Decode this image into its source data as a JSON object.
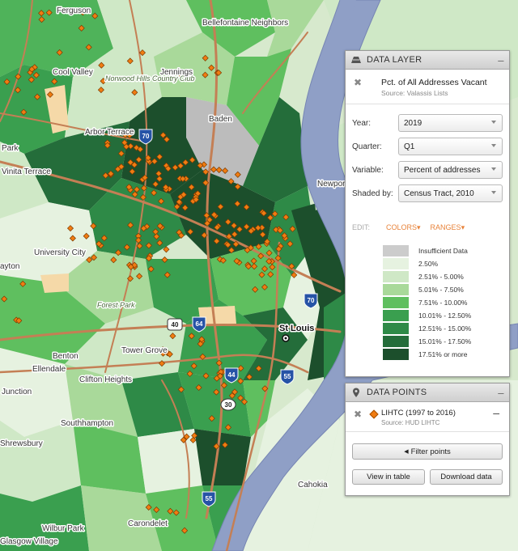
{
  "map": {
    "places": [
      "Ferguson",
      "Bellefontaine Neighbors",
      "Cool Valley",
      "Norwood Hills Country Club",
      "Jennings",
      "Arbor Terrace",
      "Baden",
      "Park",
      "Vinita Terrace",
      "Newport",
      "University City",
      "ayton",
      "Forest Park",
      "St Louis",
      "Tower Grove",
      "Benton",
      "Ellendale",
      "Clifton Heights",
      "Junction",
      "Southhampton",
      "Shrewsbury",
      "Cahokia",
      "Wilbur Park",
      "Carondelet",
      "Glasgow Village"
    ],
    "shields": {
      "i70_a": "70",
      "i70_b": "70",
      "us40": "40",
      "i64": "64",
      "i44": "44",
      "i55_a": "55",
      "i55_b": "55",
      "mo30": "30"
    },
    "colors": {
      "river": "#8f9fc6",
      "road": "#c47f55",
      "marker": "#f07c12"
    }
  },
  "data_layer": {
    "header": "DATA LAYER",
    "title": "Pct. of All Addresses Vacant",
    "source": "Source: Valassis Lists",
    "fields": {
      "year": {
        "label": "Year:",
        "value": "2019"
      },
      "quarter": {
        "label": "Quarter:",
        "value": "Q1"
      },
      "variable": {
        "label": "Variable:",
        "value": "Percent of addresses"
      },
      "shaded": {
        "label": "Shaded by:",
        "value": "Census Tract, 2010"
      }
    },
    "edit_label": "EDIT:",
    "colors_link": "COLORS",
    "ranges_link": "RANGES",
    "legend": [
      {
        "label": "Insufficient Data",
        "color": "#cccccc"
      },
      {
        "label": "2.50%",
        "color": "#e6f2e0"
      },
      {
        "label": "2.51% - 5.00%",
        "color": "#cfe8c6"
      },
      {
        "label": "5.01% - 7.50%",
        "color": "#a9d99a"
      },
      {
        "label": "7.51% - 10.00%",
        "color": "#5fbf5f"
      },
      {
        "label": "10.01% - 12.50%",
        "color": "#3a9f4f"
      },
      {
        "label": "12.51% - 15.00%",
        "color": "#2e8a47"
      },
      {
        "label": "15.01% - 17.50%",
        "color": "#246d3a"
      },
      {
        "label": "17.51% or more",
        "color": "#1c4f2c"
      }
    ]
  },
  "data_points": {
    "header": "DATA POINTS",
    "title": "LIHTC (1997 to 2016)",
    "source": "Source: HUD LIHTC",
    "filter_label": "Filter points",
    "view_table_label": "View in table",
    "download_label": "Download data"
  }
}
